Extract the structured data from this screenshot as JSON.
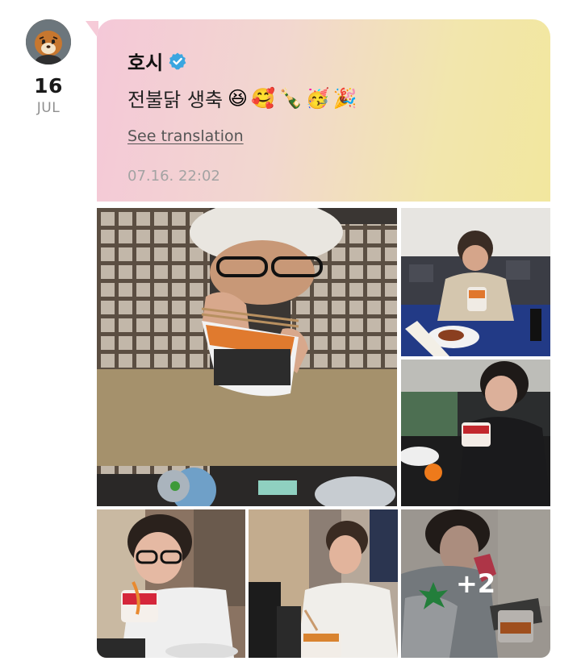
{
  "post_date": {
    "day": "16",
    "month": "JUL"
  },
  "artist": {
    "name": "호시",
    "verified_icon": "verified-badge-icon",
    "accent": "#3aa6e0"
  },
  "post": {
    "text": "전불닭 생축",
    "emojis": [
      "😆",
      "🥰",
      "🍾",
      "🥳",
      "🎉"
    ],
    "see_translation_label": "See translation",
    "timestamp": "07.16. 22:02"
  },
  "photos": {
    "more_count_label": "+2"
  },
  "colors": {
    "gradient_start": "#f4c8d8",
    "gradient_end": "#f2e79e"
  }
}
